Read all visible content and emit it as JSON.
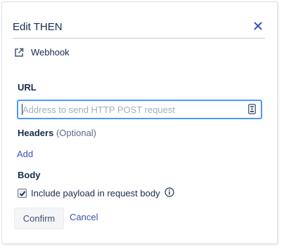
{
  "dialog": {
    "title": "Edit THEN",
    "close_icon": "close-icon"
  },
  "action": {
    "icon": "external-link-icon",
    "label": "Webhook"
  },
  "url_field": {
    "label": "URL",
    "placeholder": "Address to send HTTP POST request",
    "value": "",
    "icon": "variable-insert-icon"
  },
  "headers": {
    "label": "Headers",
    "optional": "(Optional)",
    "add_label": "Add"
  },
  "body": {
    "label": "Body",
    "checkbox_label": "Include payload in request body",
    "checked": true,
    "info_icon": "info-icon"
  },
  "footer": {
    "confirm_label": "Confirm",
    "cancel_label": "Cancel"
  },
  "colors": {
    "link": "#3a52b0",
    "focus_border": "#4c9aff",
    "text": "#172b4d"
  }
}
